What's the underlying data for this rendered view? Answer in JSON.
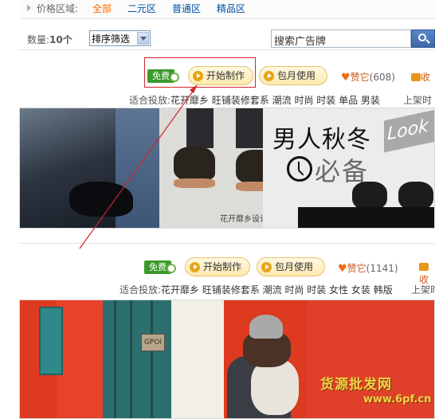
{
  "filter": {
    "label": "价格区域:",
    "options": [
      "全部",
      "二元区",
      "普通区",
      "精品区"
    ]
  },
  "toolbar": {
    "count_label": "数量:",
    "count_value": "10个",
    "sort_value": "排序筛选",
    "search_placeholder": "搜索广告牌"
  },
  "ads": [
    {
      "free": "免费",
      "start": "开始制作",
      "monthly": "包月使用",
      "like_label": "赞它",
      "like_count": "(608)",
      "fav_label": "收",
      "suitable": "适合投放:",
      "tags": "花开靡乡 旺铺装修套系 潮流 时尚 时装 单品 男装",
      "updated": "上架时",
      "banner": {
        "headline": "男人秋冬",
        "subline": "必备",
        "look": "Look",
        "signature": "花开靡乡设计"
      }
    },
    {
      "free": "免费",
      "start": "开始制作",
      "monthly": "包月使用",
      "like_label": "赞它",
      "like_count": "(1141)",
      "fav_label": "收",
      "suitable": "适合投放:",
      "tags": "花开靡乡 旺铺装修套系 潮流 时尚 时装 女性 女装 韩版",
      "updated": "上架时",
      "banner": {
        "plate": "GPOI",
        "watermark": "货源批发网",
        "watermark_url": "www.6pf.cn"
      }
    }
  ],
  "colors": {
    "accent_orange": "#ff6600",
    "link_blue": "#0050a0",
    "free_green": "#3c9a2a",
    "highlight_red": "#d2232a"
  }
}
